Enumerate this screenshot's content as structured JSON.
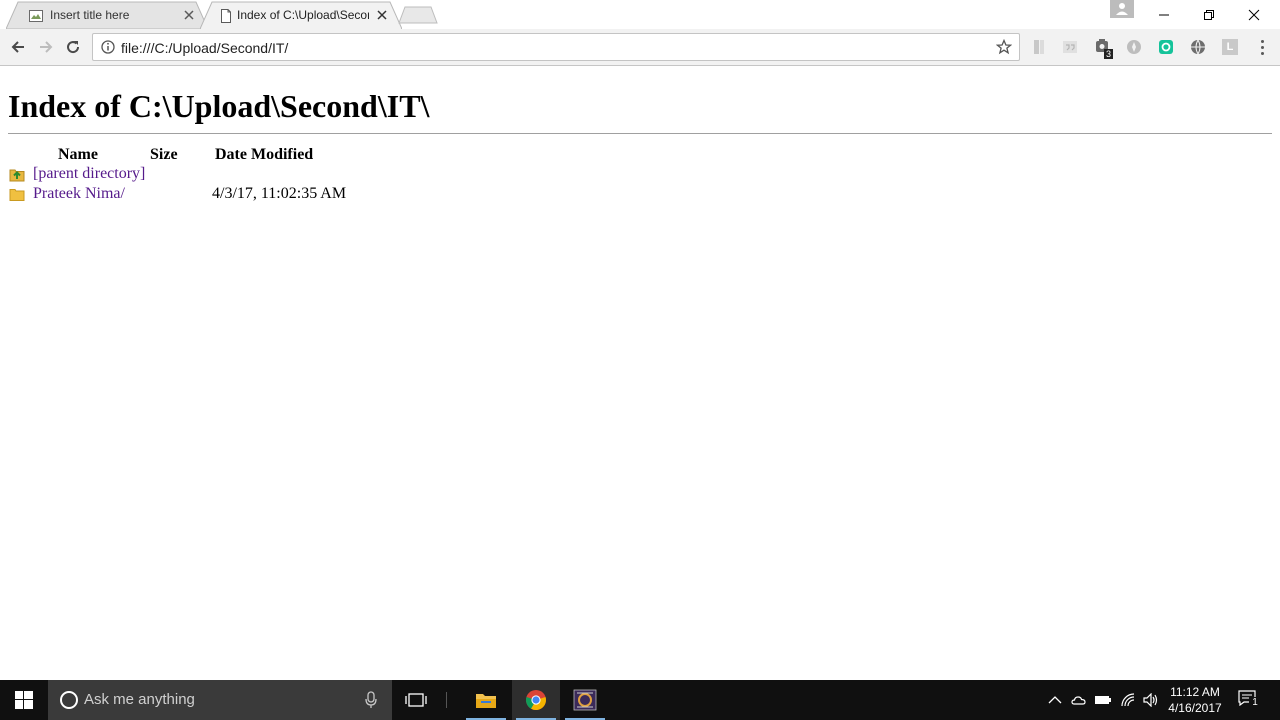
{
  "browser": {
    "tabs": [
      {
        "title": "Insert title here",
        "active": false
      },
      {
        "title": "Index of C:\\Upload\\Second\\IT\\",
        "active": true
      }
    ],
    "address": "file:///C:/Upload/Second/IT/",
    "extension_badge": "3",
    "extension_letter": "L"
  },
  "page": {
    "heading": "Index of C:\\Upload\\Second\\IT\\",
    "columns": {
      "name": "Name",
      "size": "Size",
      "date": "Date Modified"
    },
    "rows": [
      {
        "name": "[parent directory]",
        "size": "",
        "date": "",
        "icon": "folder-up-icon"
      },
      {
        "name": "Prateek Nima/",
        "size": "",
        "date": "4/3/17, 11:02:35 AM",
        "icon": "folder-icon"
      }
    ],
    "link_color": "#551a8b"
  },
  "taskbar": {
    "search_placeholder": "Ask me anything",
    "time": "11:12 AM",
    "date": "4/16/2017",
    "notification_count": "1"
  }
}
